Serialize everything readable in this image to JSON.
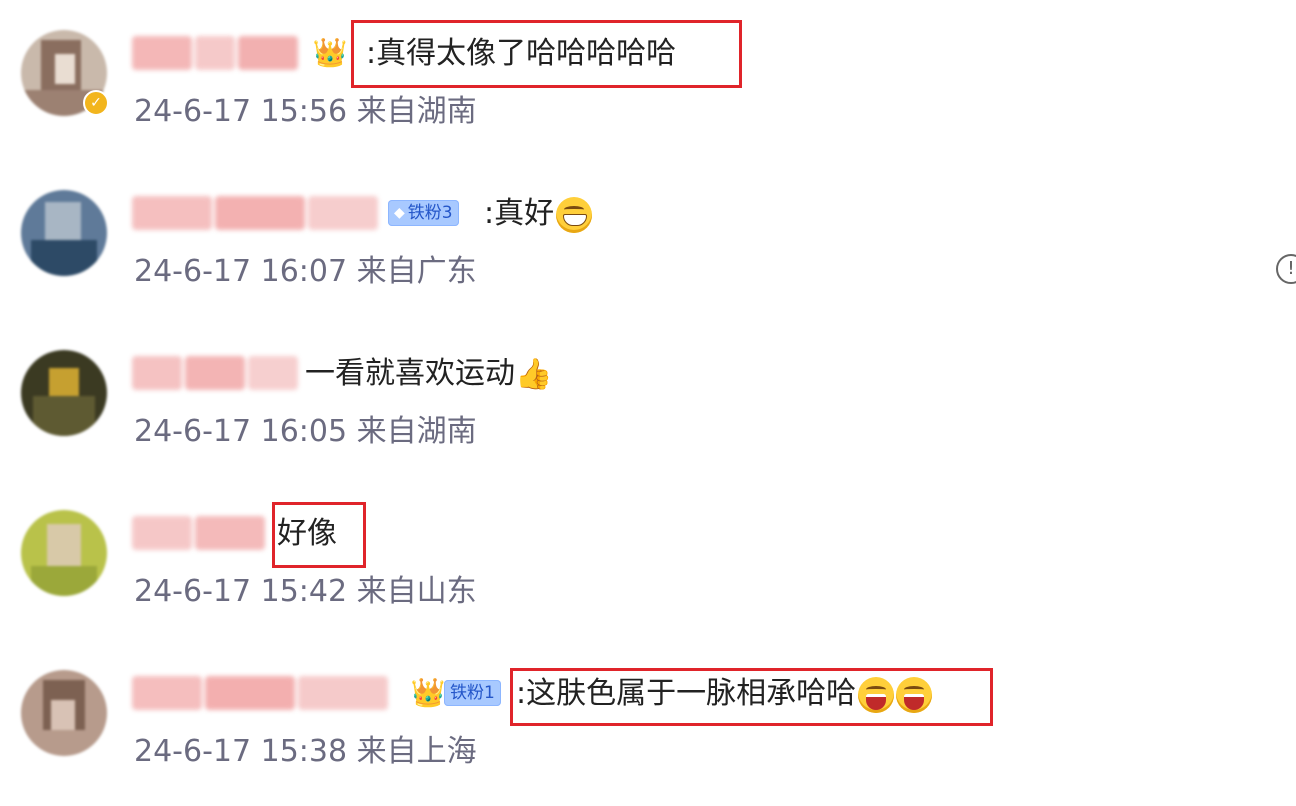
{
  "comments": [
    {
      "text": ":真得太像了哈哈哈哈哈",
      "time": "24-6-17 15:56",
      "location": "来自湖南",
      "badge": "crown"
    },
    {
      "text": ":真好",
      "time": "24-6-17 16:07",
      "location": "来自广东",
      "badge_label": "铁粉3",
      "emoji": "grin-emoji"
    },
    {
      "text": "一看就喜欢运动",
      "time": "24-6-17 16:05",
      "location": "来自湖南",
      "emoji": "thumbs-up-emoji"
    },
    {
      "text": "好像",
      "time": "24-6-17 15:42",
      "location": "来自山东"
    },
    {
      "text": ":这肤色属于一脉相承哈哈",
      "time": "24-6-17 15:38",
      "location": "来自上海",
      "badge_label": "铁粉1",
      "emoji": "laughing-emoji"
    }
  ],
  "colors": {
    "highlight_border": "#e0242a",
    "meta_text": "#6b6b80",
    "body_text": "#222222",
    "fans_badge_bg": "#a8c9ff"
  }
}
